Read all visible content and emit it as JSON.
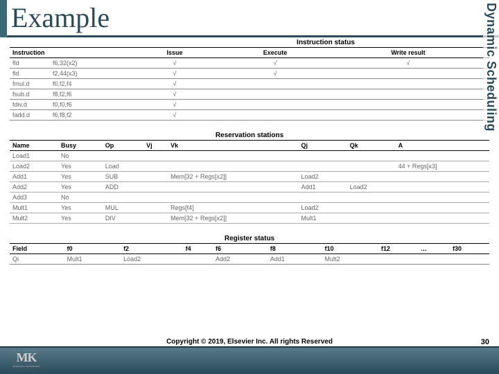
{
  "title": "Example",
  "sidebar_label": "Dynamic Scheduling",
  "table1": {
    "title": "Instruction status",
    "headers": [
      "Instruction",
      "",
      "Issue",
      "Execute",
      "Write result"
    ],
    "rows": [
      [
        "fld",
        "f6,32(x2)",
        "√",
        "√",
        "√"
      ],
      [
        "fld",
        "f2,44(x3)",
        "√",
        "√",
        ""
      ],
      [
        "fmul.d",
        "f0,f2,f4",
        "√",
        "",
        ""
      ],
      [
        "fsub.d",
        "f8,f2,f6",
        "√",
        "",
        ""
      ],
      [
        "fdiv.d",
        "f0,f0,f6",
        "√",
        "",
        ""
      ],
      [
        "fadd.d",
        "f6,f8,f2",
        "√",
        "",
        ""
      ]
    ]
  },
  "table2": {
    "title": "Reservation stations",
    "headers": [
      "Name",
      "Busy",
      "Op",
      "Vj",
      "Vk",
      "Qj",
      "Qk",
      "A"
    ],
    "rows": [
      [
        "Load1",
        "No",
        "",
        "",
        "",
        "",
        "",
        ""
      ],
      [
        "Load2",
        "Yes",
        "Load",
        "",
        "",
        "",
        "",
        "44 + Regs[x3]"
      ],
      [
        "Add1",
        "Yes",
        "SUB",
        "",
        "Mem[32 + Regs[x2]]",
        "Load2",
        "",
        ""
      ],
      [
        "Add2",
        "Yes",
        "ADD",
        "",
        "",
        "Add1",
        "Load2",
        ""
      ],
      [
        "Add3",
        "No",
        "",
        "",
        "",
        "",
        "",
        ""
      ],
      [
        "Mult1",
        "Yes",
        "MUL",
        "",
        "Regs[f4]",
        "Load2",
        "",
        ""
      ],
      [
        "Mult2",
        "Yes",
        "DIV",
        "",
        "Mem[32 + Regs[x2]]",
        "Mult1",
        "",
        ""
      ]
    ]
  },
  "table3": {
    "title": "Register status",
    "headers": [
      "Field",
      "f0",
      "f2",
      "f4",
      "f6",
      "f8",
      "f10",
      "f12",
      "…",
      "f30"
    ],
    "rows": [
      [
        "Qi",
        "Mult1",
        "Load2",
        "",
        "Add2",
        "Add1",
        "Mult2",
        "",
        "",
        ""
      ]
    ]
  },
  "copyright": "Copyright © 2019, Elsevier Inc. All rights Reserved",
  "pagenum": "30",
  "logo": {
    "main": "MK",
    "sub": "MORGAN KAUFMANN"
  }
}
